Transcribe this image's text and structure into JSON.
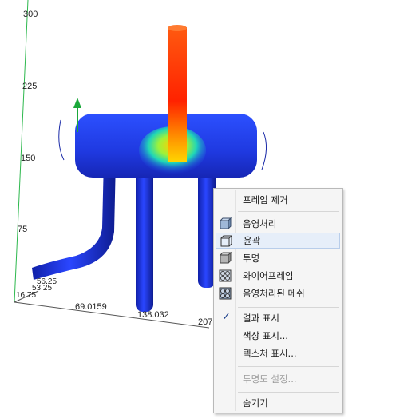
{
  "viewport": {
    "axis_ticks_vertical": [
      "300",
      "225",
      "150",
      "75"
    ],
    "axis_ticks_horizontal": [
      "69.0159",
      "138.032",
      "207"
    ],
    "axis_origin_labels": [
      "16.75",
      "53.25",
      "56.25"
    ]
  },
  "colors": {
    "pipe_blue": "#1c2fd6",
    "hot_red": "#ff2a00",
    "axis_green": "#2db84d",
    "menu_bg": "#f5f5f5",
    "menu_highlight": "#e6eef9"
  },
  "context_menu": {
    "items": [
      {
        "label": "프레임 제거",
        "icon": "",
        "checked": false,
        "disabled": false
      },
      {
        "label": "음영처리",
        "icon": "shaded-cube-icon",
        "checked": false,
        "disabled": false
      },
      {
        "label": "윤곽",
        "icon": "outline-cube-icon",
        "checked": false,
        "disabled": false,
        "highlighted": true
      },
      {
        "label": "투명",
        "icon": "transparent-cube-icon",
        "checked": false,
        "disabled": false
      },
      {
        "label": "와이어프레임",
        "icon": "wireframe-icon",
        "checked": false,
        "disabled": false
      },
      {
        "label": "음영처리된 메쉬",
        "icon": "shaded-mesh-icon",
        "checked": false,
        "disabled": false
      },
      {
        "label": "결과 표시",
        "icon": "checkmark-icon",
        "checked": true,
        "disabled": false
      },
      {
        "label": "색상 표시...",
        "icon": "",
        "checked": false,
        "disabled": false
      },
      {
        "label": "텍스처 표시...",
        "icon": "",
        "checked": false,
        "disabled": false
      },
      {
        "label": "투명도 설정...",
        "icon": "",
        "checked": false,
        "disabled": true
      },
      {
        "label": "숨기기",
        "icon": "",
        "checked": false,
        "disabled": false
      }
    ]
  }
}
